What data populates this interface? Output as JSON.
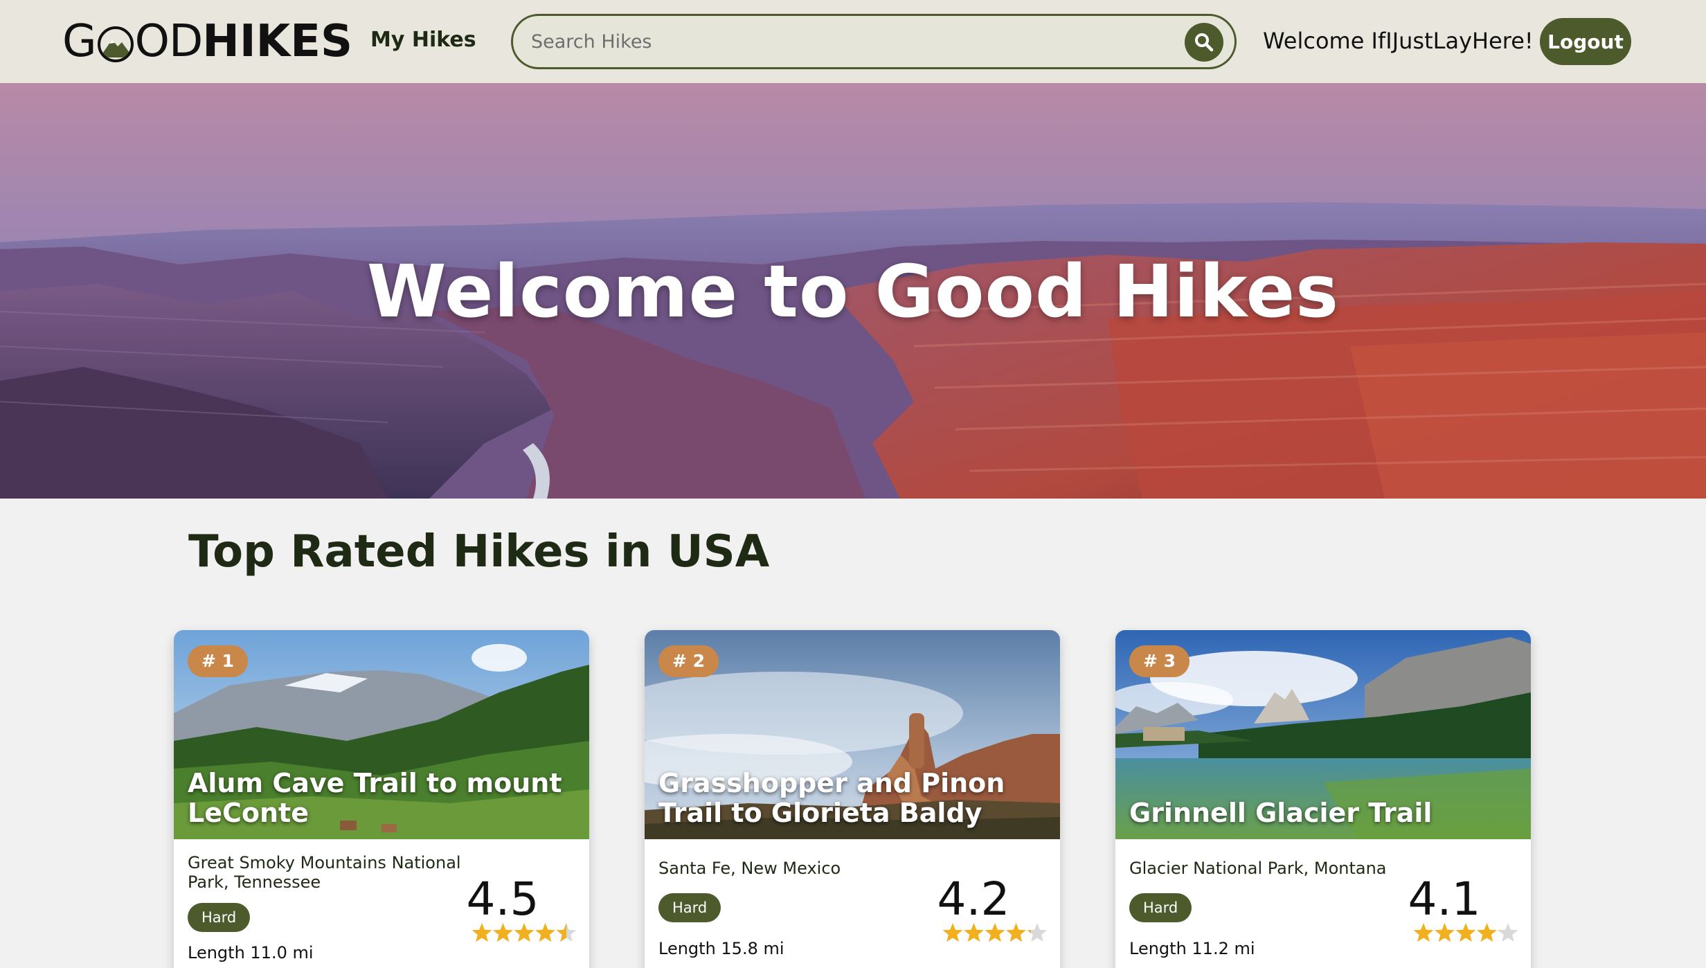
{
  "header": {
    "logo_part1": "G",
    "logo_part2": "OD",
    "logo_part3": "HIKES",
    "nav_my_hikes": "My Hikes",
    "search_placeholder": "Search Hikes",
    "welcome_text": "Welcome IfIJustLayHere!",
    "logout_label": "Logout"
  },
  "hero": {
    "title": "Welcome to Good Hikes"
  },
  "section": {
    "title": "Top Rated Hikes in USA"
  },
  "hikes": [
    {
      "rank": "# 1",
      "name": "Alum Cave Trail to mount LeConte",
      "location": "Great Smoky Mountains National Park, Tennessee",
      "difficulty": "Hard",
      "length": "Length 11.0 mi",
      "rating": "4.5",
      "rating_value": 4.5
    },
    {
      "rank": "# 2",
      "name": "Grasshopper and Pinon Trail to Glorieta Baldy",
      "location": "Santa Fe, New Mexico",
      "difficulty": "Hard",
      "length": "Length 15.8 mi",
      "rating": "4.2",
      "rating_value": 4.2
    },
    {
      "rank": "# 3",
      "name": "Grinnell Glacier Trail",
      "location": "Glacier National Park, Montana",
      "difficulty": "Hard",
      "length": "Length 11.2 mi",
      "rating": "4.1",
      "rating_value": 4.1
    }
  ],
  "colors": {
    "brand_green": "#4d5a2c",
    "header_bg": "#e9e7dd",
    "rank_badge": "#c9874a",
    "star": "#f2b01e",
    "star_empty": "#d9d9d9"
  },
  "icons": {
    "search": "search-icon",
    "logo_mountain": "mountain-logo-icon",
    "star": "star-icon"
  }
}
